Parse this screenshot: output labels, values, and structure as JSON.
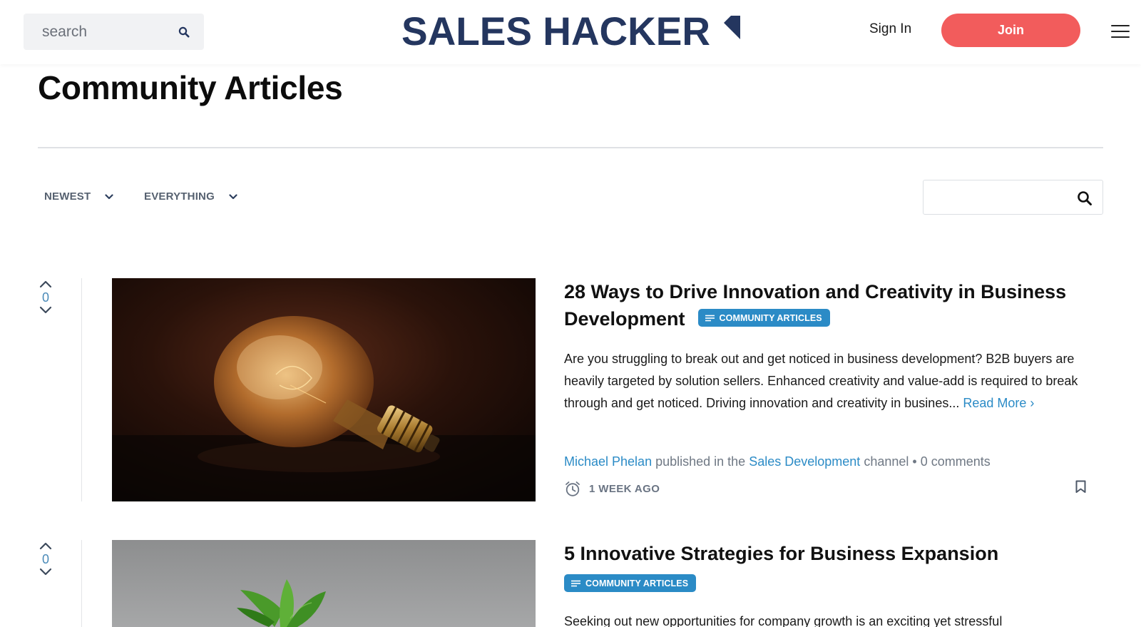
{
  "header": {
    "search_placeholder": "search",
    "logo_text": "SALES HACKER",
    "signin_label": "Sign In",
    "join_label": "Join"
  },
  "page": {
    "title": "Community Articles"
  },
  "filters": {
    "sort_label": "NEWEST",
    "type_label": "EVERYTHING",
    "search_value": ""
  },
  "articles": [
    {
      "votes": "0",
      "title": "28 Ways to Drive Innovation and Creativity in Business Development",
      "badge": "COMMUNITY ARTICLES",
      "excerpt": "Are you struggling to break out and get noticed in business development? B2B buyers are heavily targeted by solution sellers. Enhanced creativity and value-add is required to break through and get noticed. Driving innovation and creativity in busines...",
      "read_more": "Read More ›",
      "author": "Michael Phelan",
      "published_in": "published in the",
      "channel": "Sales Development",
      "channel_suffix": "channel •",
      "comments": "0 comments",
      "time": "1 WEEK AGO",
      "image": "lightbulb-image"
    },
    {
      "votes": "0",
      "title": "5 Innovative Strategies for Business Expansion",
      "badge": "COMMUNITY ARTICLES",
      "excerpt": "Seeking out new opportunities for company growth is an exciting yet stressful",
      "image": "plant-sprout-image"
    }
  ],
  "colors": {
    "brand_navy": "#24365f",
    "join_red": "#f25c5c",
    "link_blue": "#2b8bc6",
    "badge_blue": "#2b8bc6",
    "muted_text": "#6f7884"
  },
  "icons": {
    "header_search": "search-icon",
    "menu": "hamburger-menu-icon",
    "filter_chevron": "chevron-down-icon",
    "filter_search": "search-icon",
    "vote_up": "chevron-up-icon",
    "vote_down": "chevron-down-icon",
    "badge": "list-lines-icon",
    "time": "alarm-clock-icon",
    "bookmark": "bookmark-icon"
  }
}
